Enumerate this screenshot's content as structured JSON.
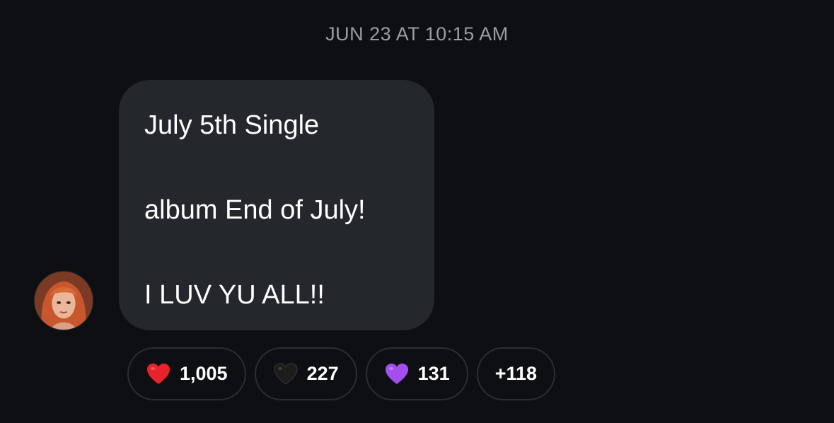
{
  "timestamp": "JUN 23 AT 10:15 AM",
  "message": {
    "lines": [
      "July 5th Single",
      "album End of July!",
      "I LUV YU ALL!!"
    ]
  },
  "reactions": [
    {
      "icon": "red-heart-icon",
      "color": "#e8232b",
      "count": "1,005"
    },
    {
      "icon": "black-heart-icon",
      "color": "#1c1c1c",
      "count": "227"
    },
    {
      "icon": "purple-heart-icon",
      "color": "#a44ef0",
      "count": "131"
    },
    {
      "count": "+118"
    }
  ],
  "colors": {
    "background": "#0d0f13",
    "bubble": "#24272c",
    "timestamp": "#9a9ea6",
    "pill_border": "#2a2d33"
  }
}
